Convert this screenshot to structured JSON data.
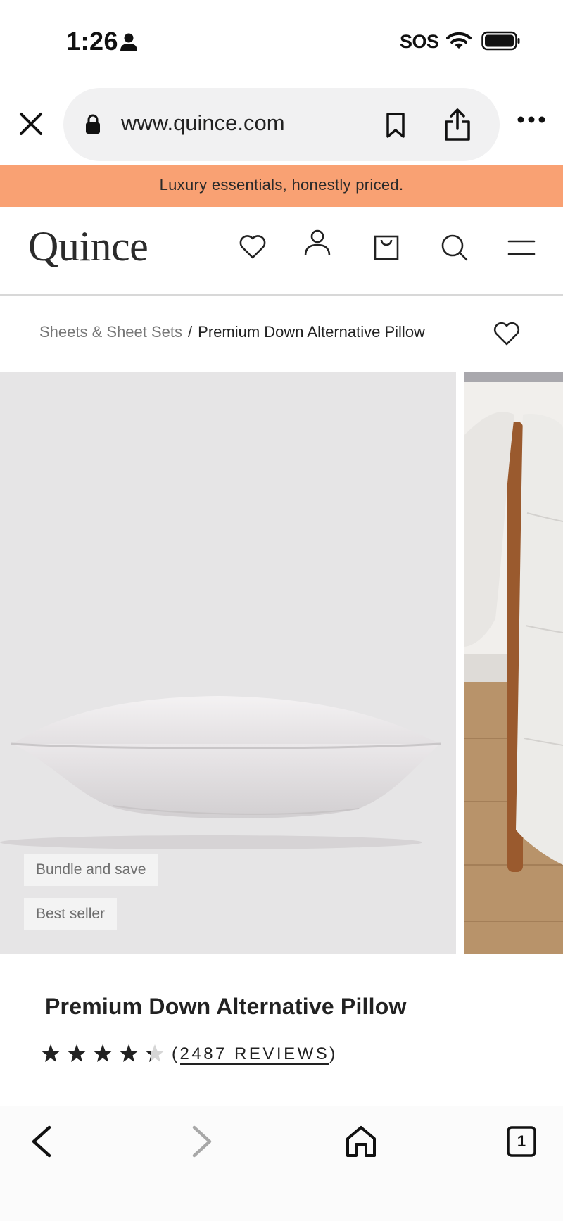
{
  "status_bar": {
    "time": "1:26",
    "carrier_status": "SOS",
    "icons": [
      "person-icon",
      "wifi-icon",
      "battery-icon"
    ]
  },
  "browser": {
    "url": "www.quince.com",
    "icons": [
      "close-icon",
      "lock-icon",
      "bookmark-icon",
      "share-icon",
      "more-icon"
    ]
  },
  "promo": {
    "text": "Luxury essentials, honestly priced.",
    "bg_color": "#f9a173"
  },
  "header": {
    "logo": "Quince",
    "icons": [
      "heart-icon",
      "account-icon",
      "bag-icon",
      "search-icon",
      "menu-icon"
    ]
  },
  "breadcrumb": {
    "parent": "Sheets & Sheet Sets",
    "separator": "/",
    "current": "Premium Down Alternative Pillow"
  },
  "gallery": {
    "badges": [
      "Bundle and save",
      "Best seller"
    ]
  },
  "product": {
    "title": "Premium Down Alternative Pillow",
    "rating": 4.5,
    "reviews_open": "(",
    "reviews_label": "2487 REVIEWS",
    "reviews_close": ")"
  },
  "toolbar": {
    "tab_count": "1",
    "icons": [
      "back-icon",
      "forward-icon",
      "home-icon",
      "tabs-icon"
    ]
  }
}
